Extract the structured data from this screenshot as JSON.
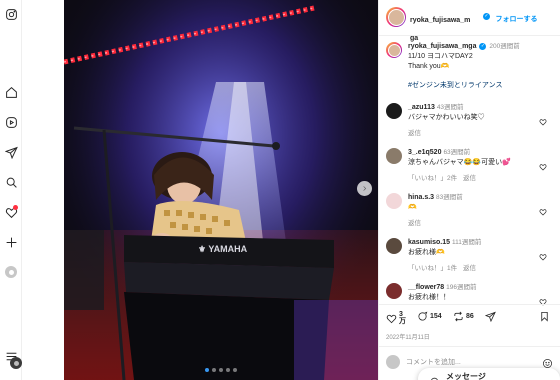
{
  "post": {
    "username": "ryoka_fujisawa_mga",
    "header_username": "ryoka_fujisawa_m\nga",
    "follow_label": "フォローする",
    "time_ago": "200週間前",
    "caption_line1": "11/10 ヨコハマDAY2",
    "caption_line2": "Thank you🫶",
    "hashtag": "#ゼンジン未到とリライアンス",
    "likes": "3\n万",
    "comments_count": "154",
    "reposts_count": "86",
    "date": "2022年11月11日",
    "image_alt": "YAMAHA keyboard on stage"
  },
  "comments": [
    {
      "user": "_azu113",
      "time": "43週間前",
      "text": "バジャマかわいいね笑♡",
      "reply": "返信",
      "likes": "",
      "avatar": "#1b1b1b"
    },
    {
      "user": "3_.e1q520",
      "time": "63週間前",
      "text": "涼ちゃんバジャマ😂😂可愛い💕",
      "reply": "返信",
      "likes": "「いいね！」2件",
      "avatar": "#8a7b6a"
    },
    {
      "user": "hina.s.3",
      "time": "83週間前",
      "text": "🫶",
      "reply": "返信",
      "likes": "",
      "avatar": "#f2d7d9"
    },
    {
      "user": "kasumiso.15",
      "time": "111週間前",
      "text": "お疲れ様🫶",
      "reply": "返信",
      "likes": "「いいね！」1件",
      "avatar": "#5a4a3e"
    },
    {
      "user": "__flower78",
      "time": "196週間前",
      "text": "お疲れ様！！",
      "reply": "返信",
      "likes": "",
      "avatar": "#7b2d2d"
    }
  ],
  "add_comment": {
    "placeholder": "コメントを追加..."
  },
  "messages_label": "メッセージ",
  "colors": {
    "accent": "#0095f6",
    "notification": "#ff3040",
    "hashtag": "#00376b"
  },
  "icons": [
    "instagram-icon",
    "threads-icon",
    "send-icon",
    "search-icon",
    "heart-icon",
    "plus-icon",
    "profile-icon",
    "menu-icon"
  ]
}
